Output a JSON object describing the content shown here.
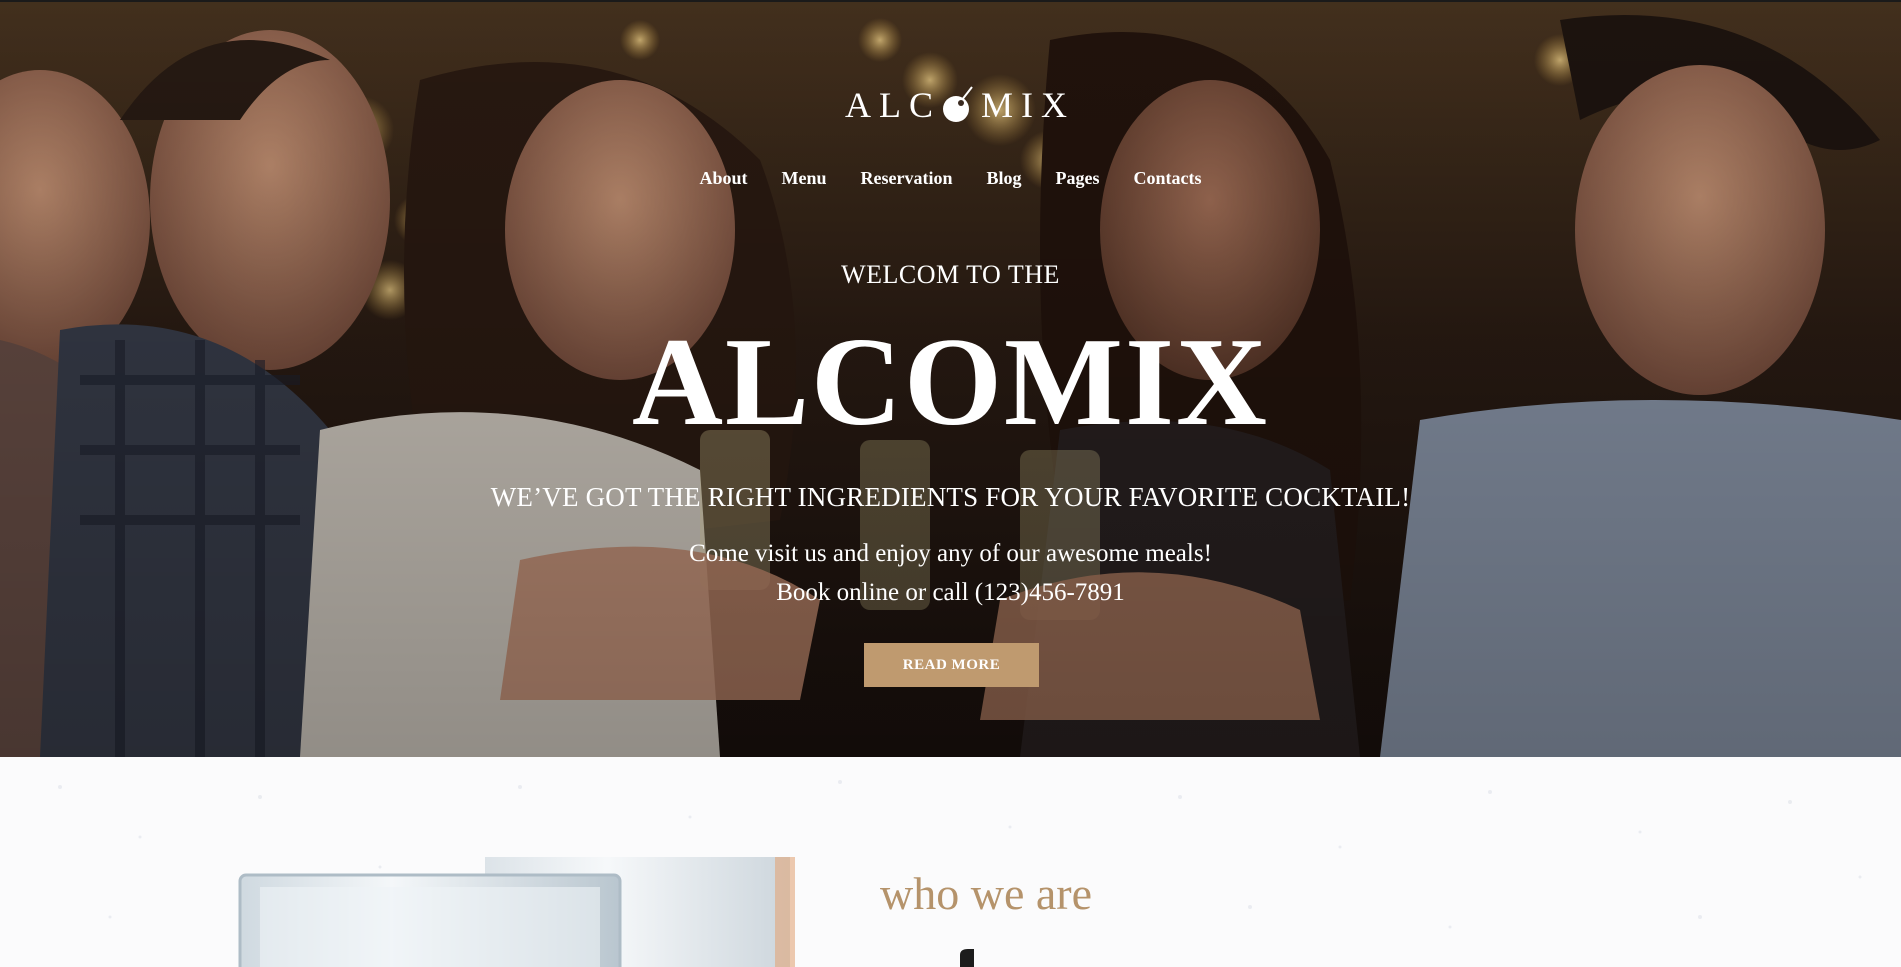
{
  "header": {
    "logo_text_left": "ALC",
    "logo_text_right": "MIX",
    "logo_icon": "cherry-olive-icon",
    "nav": [
      {
        "label": "About"
      },
      {
        "label": "Menu"
      },
      {
        "label": "Reservation"
      },
      {
        "label": "Blog"
      },
      {
        "label": "Pages"
      },
      {
        "label": "Contacts"
      }
    ]
  },
  "hero": {
    "welcome": "WELCOM TO THE",
    "brand": "ALCOMIX",
    "tagline": "WE’VE GOT THE RIGHT INGREDIENTS FOR YOUR FAVORITE COCKTAIL!",
    "line1": "Come visit us and enjoy any of our awesome meals!",
    "line2": "Book online or call (123)456-7891",
    "cta_label": "READ MORE",
    "image_subject": "friends-toasting-photo"
  },
  "about": {
    "heading": "who we are",
    "image_subject": "cocktail-glasses-photo"
  },
  "colors": {
    "accent": "#bf9a6f",
    "heading_accent": "#b5936b",
    "hero_text": "#ffffff"
  }
}
